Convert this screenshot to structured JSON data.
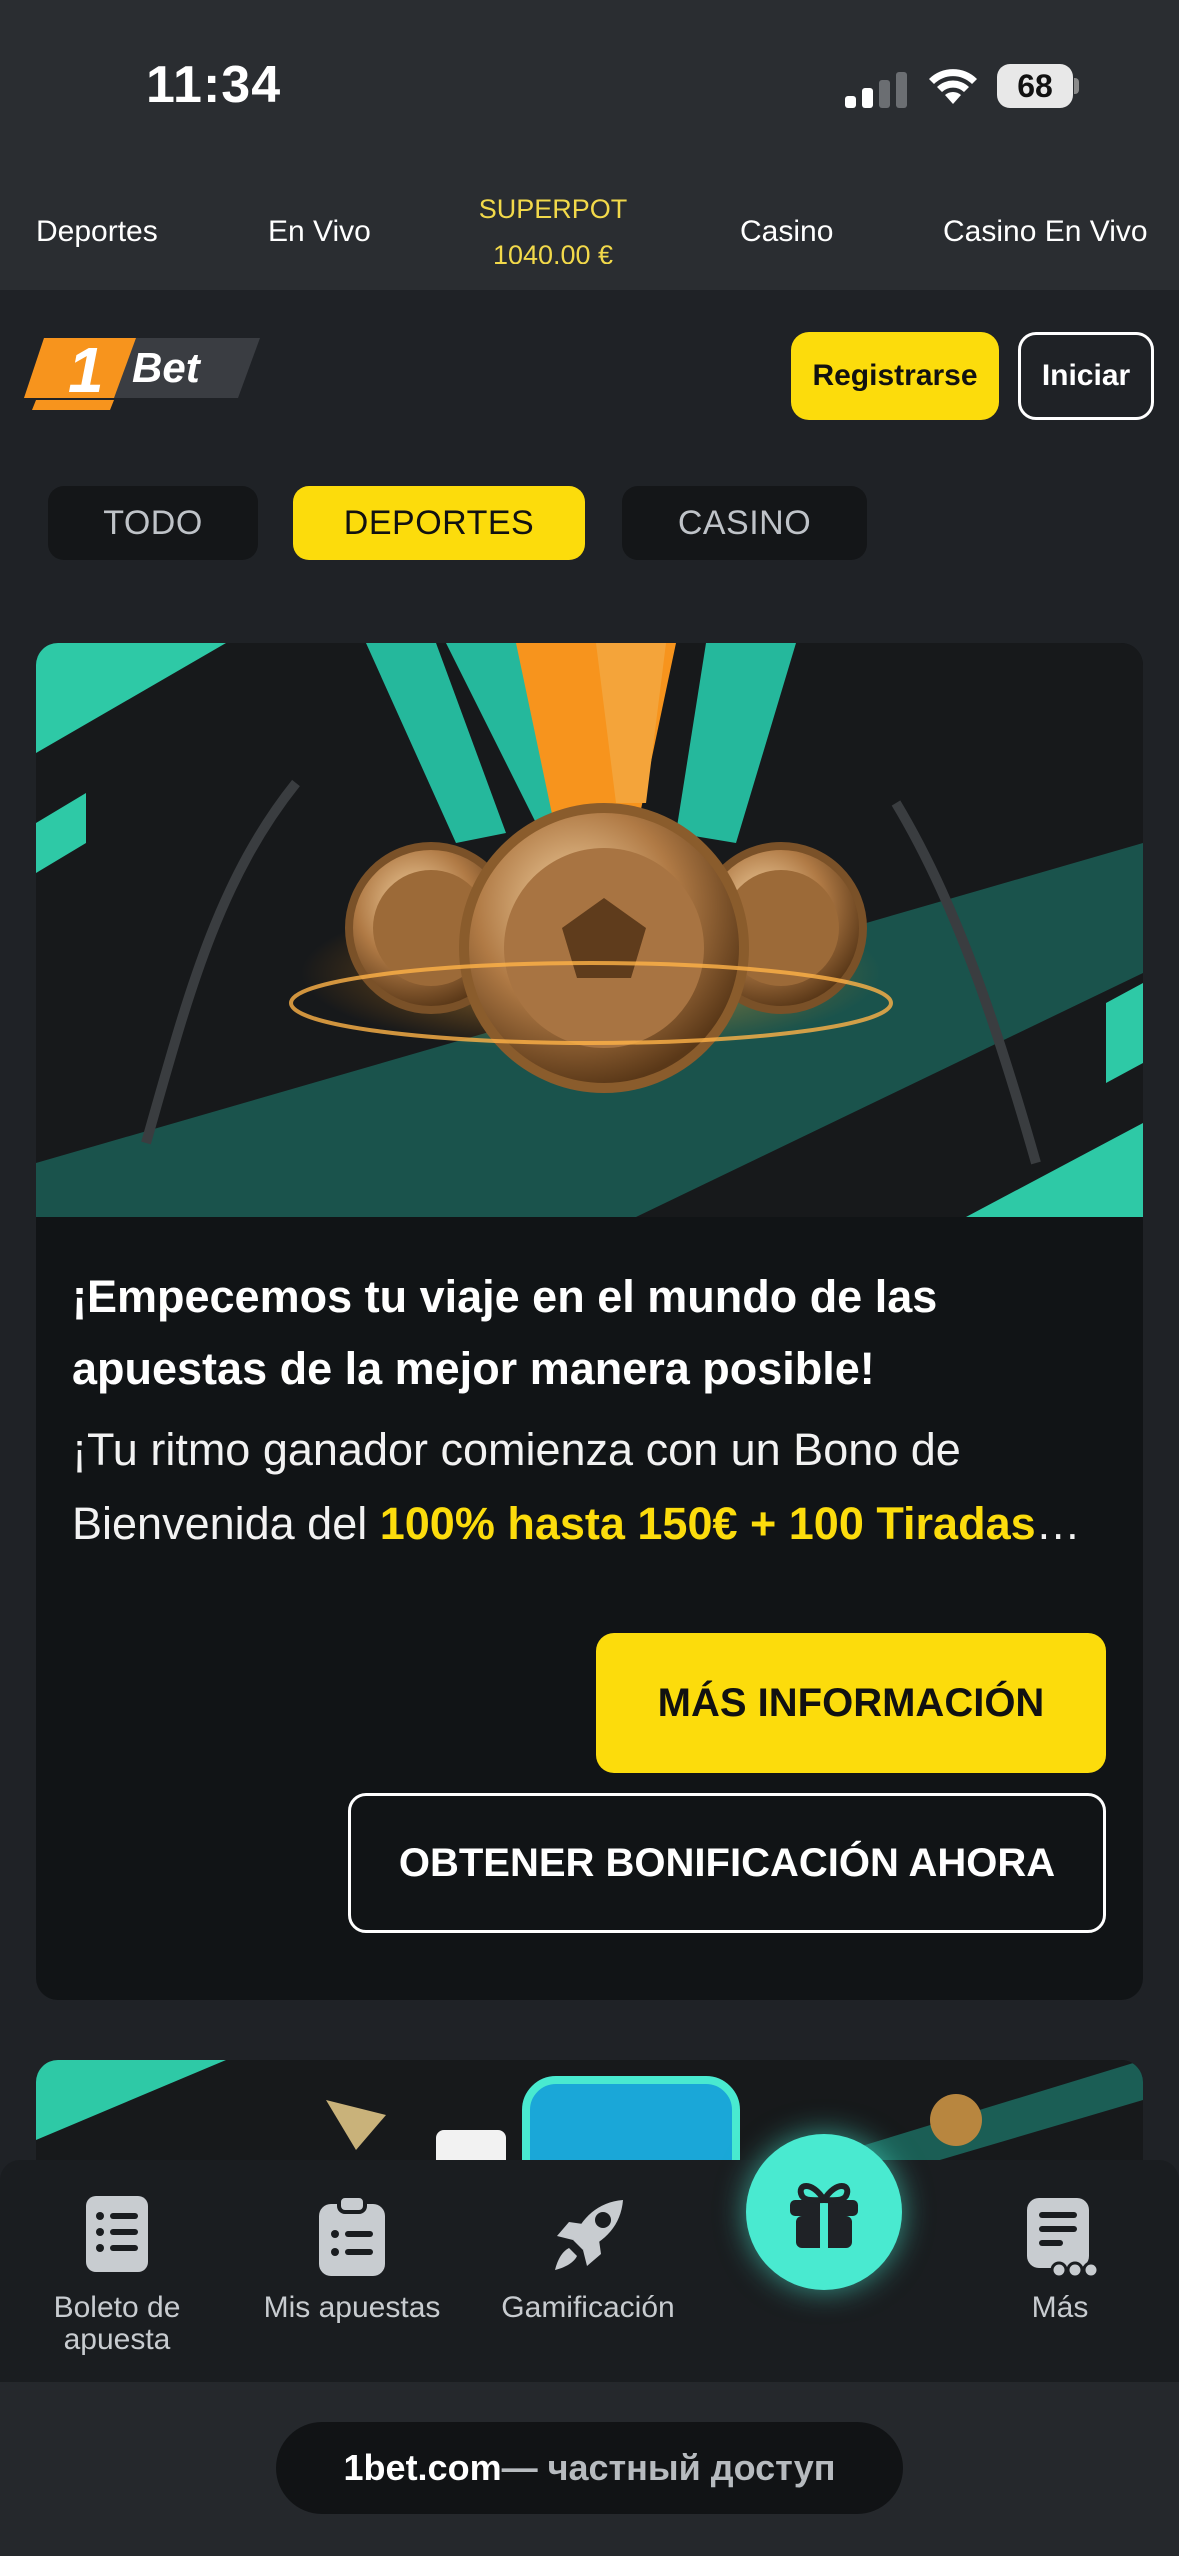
{
  "status": {
    "time": "11:34",
    "battery": "68"
  },
  "top_nav": {
    "items": [
      "Deportes",
      "En Vivo",
      "Casino",
      "Casino En Vivo"
    ],
    "superpot": {
      "title": "SUPERPOT",
      "amount": "1040.00 €"
    }
  },
  "header": {
    "register_label": "Registrarse",
    "login_label": "Iniciar",
    "logo_text": "Bet",
    "logo_number": "1"
  },
  "filters": {
    "todo": "TODO",
    "deportes": "DEPORTES",
    "casino": "CASINO",
    "active": "DEPORTES"
  },
  "promo": {
    "title": "¡Empecemos tu viaje en el mundo de las apuestas de la mejor manera posible!",
    "desc_prefix": " ¡Tu ritmo ganador comienza con un Bono de Bienvenida del ",
    "desc_highlight": "100% hasta 150€ + 100 Tiradas",
    "desc_ellipsis": "…",
    "more_label": "MÁS INFORMACIÓN",
    "bonus_label": "OBTENER BONIFICACIÓN AHORA"
  },
  "bottom_nav": {
    "items": [
      {
        "label": "Boleto de apuesta",
        "icon": "betslip-icon"
      },
      {
        "label": "Mis apuestas",
        "icon": "clipboard-icon"
      },
      {
        "label": "Gamificación",
        "icon": "rocket-icon"
      },
      {
        "label": "",
        "icon": "gift-icon"
      },
      {
        "label": "Más",
        "icon": "more-icon"
      }
    ]
  },
  "browser": {
    "domain": "1bet.com",
    "suffix": " — частный доступ"
  },
  "colors": {
    "accent": "#fcdc0c",
    "teal": "#49ead0",
    "bg": "#1f2226",
    "card": "#111416"
  }
}
